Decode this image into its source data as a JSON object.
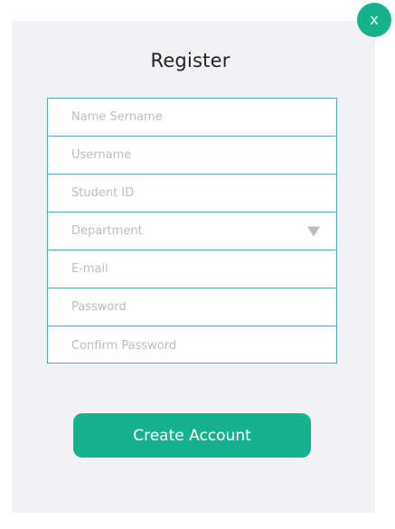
{
  "window": {
    "title": "Register",
    "close_label": "x"
  },
  "form": {
    "fields": [
      {
        "placeholder": "Name Sername"
      },
      {
        "placeholder": "Username"
      },
      {
        "placeholder": "Student ID"
      },
      {
        "placeholder": "Department"
      },
      {
        "placeholder": "E-mail"
      },
      {
        "placeholder": "Password"
      },
      {
        "placeholder": "Confirm Password"
      }
    ],
    "submit_label": "Create Account"
  },
  "colors": {
    "accent": "#14b38e",
    "field_border": "#5aa4c8",
    "panel_bg": "#f2f2f4",
    "placeholder": "#b9bcc2"
  },
  "icons": {
    "close": "close-icon",
    "dropdown": "chevron-down-icon"
  }
}
